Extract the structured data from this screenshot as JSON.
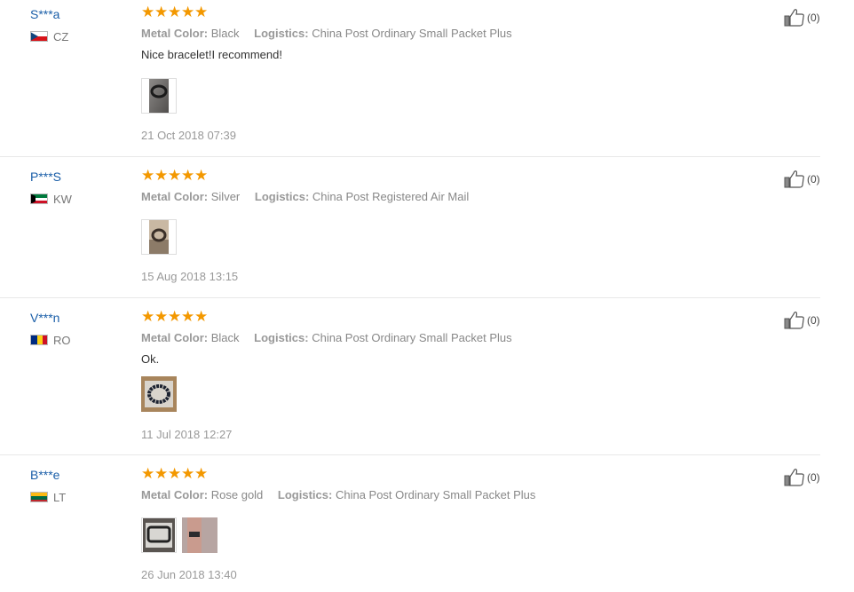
{
  "labels": {
    "metal_color": "Metal Color:",
    "logistics": "Logistics:"
  },
  "colors": {
    "star": "#f39800",
    "username": "#1a5ea8"
  },
  "reviews": [
    {
      "user": "S***a",
      "country": "CZ",
      "flag_icon": "czech-flag-icon",
      "rating": 5,
      "metal_color": "Black",
      "logistics": "China Post Ordinary Small Packet Plus",
      "text": "Nice bracelet!I recommend!",
      "photos": 1,
      "date": "21 Oct 2018 07:39",
      "likes": "(0)"
    },
    {
      "user": "P***S",
      "country": "KW",
      "flag_icon": "kuwait-flag-icon",
      "rating": 5,
      "metal_color": "Silver",
      "logistics": "China Post Registered Air Mail",
      "text": "",
      "photos": 1,
      "date": "15 Aug 2018 13:15",
      "likes": "(0)"
    },
    {
      "user": "V***n",
      "country": "RO",
      "flag_icon": "romania-flag-icon",
      "rating": 5,
      "metal_color": "Black",
      "logistics": "China Post Ordinary Small Packet Plus",
      "text": "Ok.",
      "photos": 1,
      "date": "11 Jul 2018 12:27",
      "likes": "(0)"
    },
    {
      "user": "B***e",
      "country": "LT",
      "flag_icon": "lithuania-flag-icon",
      "rating": 5,
      "metal_color": "Rose gold",
      "logistics": "China Post Ordinary Small Packet Plus",
      "text": "",
      "photos": 2,
      "date": "26 Jun 2018 13:40",
      "likes": "(0)"
    }
  ]
}
